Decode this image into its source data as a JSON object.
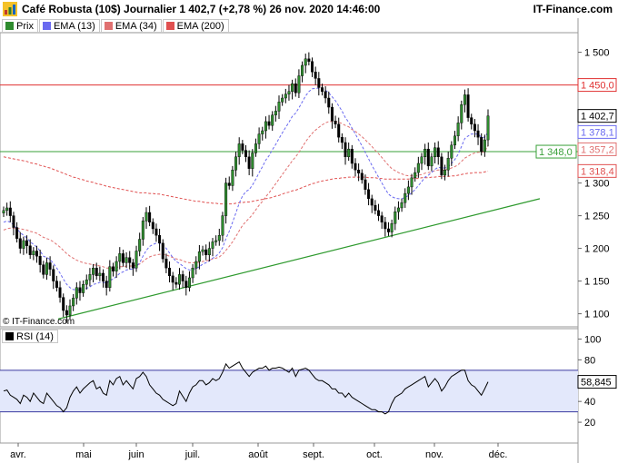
{
  "header": {
    "title": "Café Robusta (10$) Journalier 1 402,7 (+2,78 %) 26 nov. 2020 14:46:00",
    "brand": "IT-Finance.com",
    "copyright": "© IT-Finance.com"
  },
  "legend": [
    {
      "label": "Prix",
      "color": "#2e8b2e"
    },
    {
      "label": "EMA (13)",
      "color": "#6a6af0"
    },
    {
      "label": "EMA (34)",
      "color": "#e07070"
    },
    {
      "label": "EMA (200)",
      "color": "#e05050"
    }
  ],
  "rsi_panel": {
    "label": "RSI (14)"
  },
  "colors": {
    "up": "#2e8b2e",
    "down": "#000000",
    "resistance": "#e03030",
    "support": "#3aa03a",
    "trend": "#2e9a2e",
    "rsi_band": "#e3e8fb",
    "rsi_line": "#000000",
    "rsi_bounds": "#3a3aa0"
  },
  "chart_data": {
    "type": "candlestick",
    "x_tick_labels": [
      "avr.",
      "mai",
      "juin",
      "juil.",
      "août",
      "sept.",
      "oct.",
      "nov.",
      "déc."
    ],
    "price_axis": {
      "ticks": [
        1100,
        1150,
        1200,
        1250,
        1300,
        1350,
        1400,
        1450,
        1500
      ],
      "ylim": [
        1080,
        1530
      ]
    },
    "price_tags": [
      {
        "value": 1450.0,
        "label": "1 450,0",
        "color": "#e03030"
      },
      {
        "value": 1402.7,
        "label": "1 402,7",
        "color": "#000000"
      },
      {
        "value": 1378.1,
        "label": "1 378,1",
        "color": "#6a6af0"
      },
      {
        "value": 1357.2,
        "label": "1 357,2",
        "color": "#e07070"
      },
      {
        "value": 1348.0,
        "label": "1 348,0",
        "color": "#3aa03a"
      },
      {
        "value": 1318.4,
        "label": "1 318,4",
        "color": "#e05050"
      }
    ],
    "horizontal_lines": [
      {
        "value": 1450,
        "color": "#e03030"
      },
      {
        "value": 1348,
        "color": "#3aa03a"
      }
    ],
    "trendline": {
      "start": {
        "month": "2020-04-24",
        "price": 1092
      },
      "end": {
        "month": "2020-12-13",
        "price": 1276
      }
    },
    "series": {
      "close": [
        1258,
        1262,
        1250,
        1232,
        1215,
        1200,
        1212,
        1204,
        1190,
        1196,
        1188,
        1175,
        1160,
        1178,
        1168,
        1150,
        1140,
        1125,
        1105,
        1098,
        1112,
        1124,
        1140,
        1132,
        1145,
        1152,
        1160,
        1170,
        1158,
        1162,
        1150,
        1140,
        1172,
        1165,
        1180,
        1192,
        1178,
        1186,
        1178,
        1170,
        1196,
        1214,
        1242,
        1255,
        1240,
        1230,
        1220,
        1208,
        1184,
        1170,
        1158,
        1148,
        1145,
        1160,
        1150,
        1140,
        1155,
        1170,
        1180,
        1195,
        1198,
        1190,
        1200,
        1210,
        1212,
        1220,
        1250,
        1300,
        1296,
        1320,
        1340,
        1360,
        1350,
        1340,
        1322,
        1346,
        1360,
        1375,
        1380,
        1394,
        1388,
        1404,
        1410,
        1424,
        1430,
        1436,
        1440,
        1452,
        1438,
        1464,
        1480,
        1490,
        1486,
        1470,
        1460,
        1446,
        1440,
        1430,
        1416,
        1395,
        1390,
        1370,
        1362,
        1340,
        1352,
        1330,
        1320,
        1315,
        1305,
        1290,
        1276,
        1266,
        1258,
        1250,
        1240,
        1230,
        1225,
        1238,
        1256,
        1262,
        1270,
        1284,
        1294,
        1308,
        1316,
        1330,
        1340,
        1352,
        1326,
        1340,
        1354,
        1340,
        1312,
        1320,
        1338,
        1358,
        1372,
        1392,
        1420,
        1435,
        1400,
        1390,
        1380,
        1370,
        1348,
        1366,
        1402.7
      ],
      "ema13": [
        1240,
        1242,
        1240,
        1236,
        1230,
        1224,
        1220,
        1216,
        1210,
        1206,
        1202,
        1196,
        1188,
        1186,
        1183,
        1177,
        1170,
        1162,
        1153,
        1145,
        1140,
        1137,
        1137,
        1136,
        1137,
        1139,
        1141,
        1145,
        1146,
        1148,
        1148,
        1147,
        1151,
        1153,
        1157,
        1162,
        1164,
        1167,
        1168,
        1168,
        1172,
        1178,
        1188,
        1197,
        1203,
        1206,
        1208,
        1208,
        1205,
        1200,
        1193,
        1186,
        1180,
        1177,
        1173,
        1169,
        1167,
        1167,
        1169,
        1172,
        1176,
        1178,
        1181,
        1185,
        1188,
        1193,
        1201,
        1215,
        1226,
        1240,
        1254,
        1269,
        1280,
        1287,
        1290,
        1297,
        1306,
        1316,
        1325,
        1335,
        1342,
        1351,
        1359,
        1368,
        1377,
        1385,
        1393,
        1402,
        1407,
        1415,
        1424,
        1433,
        1440,
        1444,
        1445,
        1445,
        1444,
        1442,
        1438,
        1432,
        1426,
        1418,
        1410,
        1400,
        1393,
        1384,
        1375,
        1366,
        1357,
        1347,
        1337,
        1327,
        1318,
        1309,
        1300,
        1291,
        1283,
        1279,
        1277,
        1276,
        1276,
        1278,
        1281,
        1285,
        1290,
        1296,
        1302,
        1309,
        1312,
        1316,
        1321,
        1324,
        1323,
        1323,
        1325,
        1330,
        1336,
        1344,
        1356,
        1368,
        1372,
        1375,
        1375,
        1375,
        1370,
        1370,
        1378.1
      ],
      "ema34": [
        1228,
        1230,
        1231,
        1231,
        1231,
        1230,
        1229,
        1228,
        1226,
        1225,
        1223,
        1220,
        1217,
        1215,
        1213,
        1210,
        1206,
        1202,
        1197,
        1192,
        1188,
        1185,
        1182,
        1180,
        1178,
        1177,
        1176,
        1175,
        1174,
        1173,
        1172,
        1170,
        1170,
        1170,
        1171,
        1172,
        1172,
        1173,
        1173,
        1173,
        1174,
        1176,
        1180,
        1184,
        1187,
        1189,
        1190,
        1191,
        1191,
        1190,
        1188,
        1186,
        1184,
        1183,
        1181,
        1179,
        1178,
        1178,
        1178,
        1179,
        1180,
        1181,
        1182,
        1184,
        1185,
        1187,
        1191,
        1197,
        1203,
        1210,
        1218,
        1227,
        1235,
        1241,
        1246,
        1252,
        1259,
        1266,
        1272,
        1279,
        1285,
        1292,
        1299,
        1306,
        1313,
        1320,
        1327,
        1334,
        1340,
        1347,
        1355,
        1363,
        1370,
        1376,
        1381,
        1385,
        1389,
        1392,
        1394,
        1394,
        1394,
        1393,
        1391,
        1388,
        1386,
        1382,
        1379,
        1375,
        1371,
        1366,
        1361,
        1356,
        1350,
        1345,
        1339,
        1333,
        1327,
        1322,
        1319,
        1316,
        1314,
        1312,
        1311,
        1311,
        1311,
        1312,
        1313,
        1315,
        1316,
        1317,
        1319,
        1320,
        1320,
        1320,
        1321,
        1323,
        1325,
        1328,
        1333,
        1338,
        1341,
        1344,
        1346,
        1347,
        1347,
        1348,
        1357.2
      ],
      "ema200": [
        1340,
        1339,
        1338,
        1337,
        1336,
        1335,
        1334,
        1333,
        1331,
        1330,
        1329,
        1327,
        1326,
        1324,
        1323,
        1321,
        1319,
        1317,
        1315,
        1313,
        1311,
        1309,
        1308,
        1306,
        1305,
        1303,
        1302,
        1301,
        1299,
        1298,
        1297,
        1295,
        1294,
        1293,
        1292,
        1291,
        1290,
        1289,
        1288,
        1287,
        1286,
        1285,
        1285,
        1285,
        1284,
        1284,
        1283,
        1283,
        1282,
        1281,
        1280,
        1279,
        1278,
        1277,
        1276,
        1275,
        1274,
        1273,
        1272,
        1272,
        1271,
        1270,
        1270,
        1269,
        1269,
        1268,
        1268,
        1268,
        1268,
        1268,
        1269,
        1270,
        1270,
        1271,
        1271,
        1272,
        1273,
        1274,
        1275,
        1276,
        1277,
        1278,
        1280,
        1281,
        1283,
        1285,
        1286,
        1288,
        1289,
        1291,
        1293,
        1295,
        1297,
        1299,
        1300,
        1302,
        1303,
        1304,
        1305,
        1306,
        1307,
        1307,
        1308,
        1308,
        1309,
        1309,
        1309,
        1309,
        1309,
        1309,
        1308,
        1308,
        1308,
        1307,
        1307,
        1306,
        1306,
        1306,
        1306,
        1306,
        1306,
        1306,
        1306,
        1307,
        1307,
        1307,
        1308,
        1308,
        1308,
        1309,
        1309,
        1310,
        1310,
        1310,
        1310,
        1311,
        1311,
        1312,
        1313,
        1314,
        1315,
        1315,
        1316,
        1316,
        1316,
        1317,
        1318.4
      ]
    },
    "rsi": {
      "axis_ticks": [
        20,
        40,
        60,
        80,
        100
      ],
      "upper_bound": 70,
      "lower_bound": 30,
      "last_value": 58.845,
      "last_label": "58,845",
      "values": [
        50,
        51,
        46,
        44,
        42,
        38,
        46,
        44,
        40,
        48,
        44,
        40,
        38,
        48,
        44,
        40,
        36,
        34,
        30,
        34,
        44,
        50,
        54,
        48,
        52,
        55,
        58,
        60,
        52,
        54,
        48,
        46,
        60,
        56,
        62,
        64,
        56,
        60,
        56,
        52,
        62,
        64,
        68,
        64,
        56,
        52,
        48,
        46,
        42,
        40,
        38,
        36,
        38,
        50,
        45,
        40,
        48,
        54,
        56,
        60,
        60,
        56,
        58,
        62,
        60,
        62,
        68,
        76,
        72,
        74,
        76,
        78,
        72,
        68,
        64,
        68,
        70,
        72,
        72,
        74,
        70,
        72,
        72,
        73,
        72,
        70,
        68,
        72,
        64,
        70,
        71,
        72,
        70,
        66,
        62,
        60,
        60,
        58,
        56,
        52,
        52,
        48,
        48,
        44,
        48,
        44,
        42,
        40,
        38,
        36,
        34,
        32,
        32,
        30,
        30,
        28,
        30,
        38,
        44,
        46,
        48,
        52,
        54,
        56,
        58,
        60,
        62,
        64,
        54,
        58,
        62,
        58,
        50,
        54,
        60,
        64,
        66,
        68,
        70,
        70,
        60,
        56,
        54,
        50,
        46,
        52,
        58.845
      ]
    }
  }
}
